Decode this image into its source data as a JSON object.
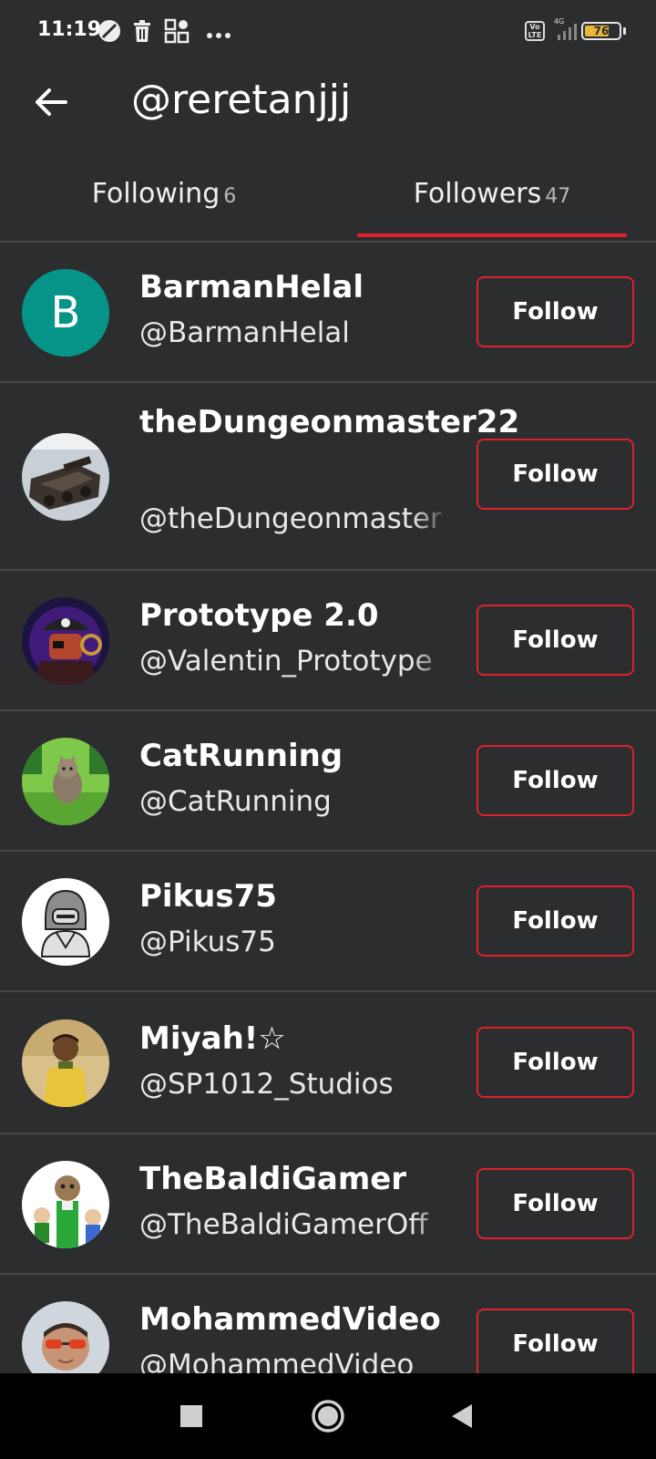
{
  "status_bar": {
    "time": "11:19",
    "network_label": "Vo LTE",
    "signal_label": "4G",
    "battery_level": 76,
    "battery_text": "76",
    "icons": [
      "vpn-icon",
      "trash-icon",
      "apps-grid-icon",
      "more-dots-icon",
      "volte-icon",
      "signal-icon",
      "battery-icon"
    ]
  },
  "header": {
    "title": "@reretanjjj",
    "back_icon": "arrow-left-icon"
  },
  "tabs": [
    {
      "label": "Following",
      "count": "6",
      "selected": false
    },
    {
      "label": "Followers",
      "count": "47",
      "selected": true
    }
  ],
  "accent_color": "#e0202a",
  "followers": [
    {
      "name": "BarmanHelal",
      "handle": "@BarmanHelal",
      "avatar": "letter",
      "avatar_letter": "B",
      "button": "Follow"
    },
    {
      "name": "theDungeonmaster22",
      "handle": "@theDungeonmaster",
      "avatar": "tank-image",
      "button": "Follow"
    },
    {
      "name": "Prototype 2.0",
      "handle": "@Valentin_Prototype",
      "avatar": "pirate-image",
      "button": "Follow"
    },
    {
      "name": "CatRunning",
      "handle": "@CatRunning",
      "avatar": "cat-image",
      "button": "Follow"
    },
    {
      "name": "Pikus75",
      "handle": "@Pikus75",
      "avatar": "hooded-character-image",
      "button": "Follow"
    },
    {
      "name": "Miyah!☆",
      "handle": "@SP1012_Studios",
      "avatar": "boy-photo",
      "button": "Follow"
    },
    {
      "name": "TheBaldiGamer",
      "handle": "@TheBaldiGamerOff",
      "avatar": "baldi-image",
      "button": "Follow"
    },
    {
      "name": "MohammedVideo",
      "handle": "@MohammedVideo",
      "avatar": "man-sunglasses-photo",
      "button": "Follow"
    }
  ],
  "nav_bar": {
    "buttons": [
      "recents-square-icon",
      "home-circle-icon",
      "back-triangle-icon"
    ]
  }
}
